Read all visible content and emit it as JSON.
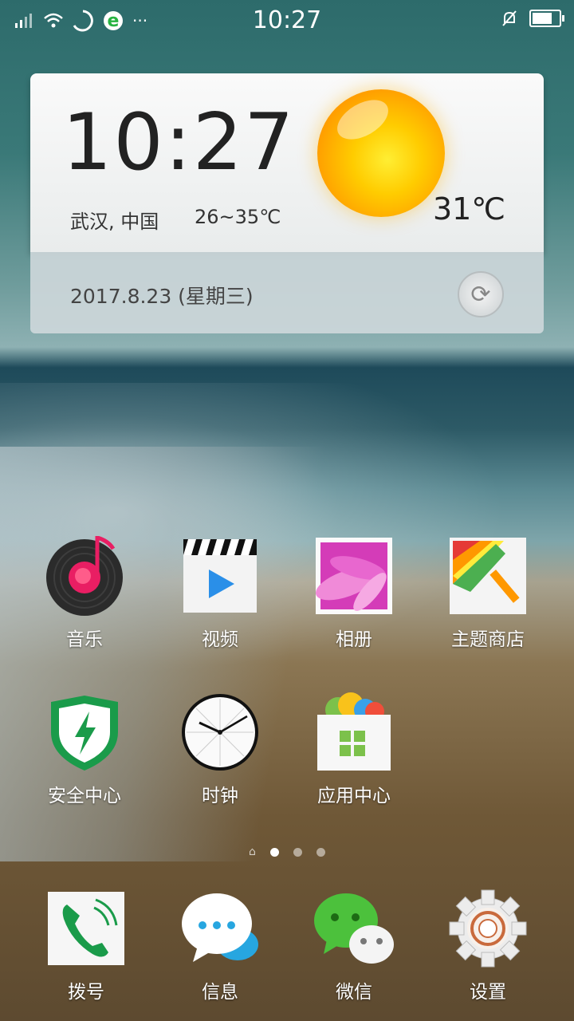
{
  "status_bar": {
    "time": "10:27",
    "left_icons": [
      "signal-icon",
      "wifi-icon",
      "loading-icon",
      "browser-e-icon",
      "more-icon"
    ],
    "right_icons": [
      "silent-bell-icon",
      "battery-icon"
    ],
    "battery_level": 0.85
  },
  "weather_widget": {
    "clock": "10:27",
    "city": "武汉, 中国",
    "temp_range": "26~35℃",
    "current_temp": "31℃",
    "date": "2017.8.23 (星期三)",
    "condition_icon": "sunny-icon"
  },
  "apps": [
    {
      "label": "音乐",
      "icon": "music-icon"
    },
    {
      "label": "视频",
      "icon": "video-icon"
    },
    {
      "label": "相册",
      "icon": "gallery-icon"
    },
    {
      "label": "主题商店",
      "icon": "theme-store-icon"
    },
    {
      "label": "安全中心",
      "icon": "security-center-icon"
    },
    {
      "label": "时钟",
      "icon": "clock-icon"
    },
    {
      "label": "应用中心",
      "icon": "app-center-icon"
    }
  ],
  "page_indicator": {
    "pages": 3,
    "current": 1
  },
  "dock": [
    {
      "label": "拨号",
      "icon": "phone-icon"
    },
    {
      "label": "信息",
      "icon": "messages-icon"
    },
    {
      "label": "微信",
      "icon": "wechat-icon"
    },
    {
      "label": "设置",
      "icon": "settings-icon"
    }
  ],
  "colors": {
    "accent_green": "#1a9b4a",
    "music_red": "#e91e63",
    "sun_orange": "#ff9a00"
  }
}
